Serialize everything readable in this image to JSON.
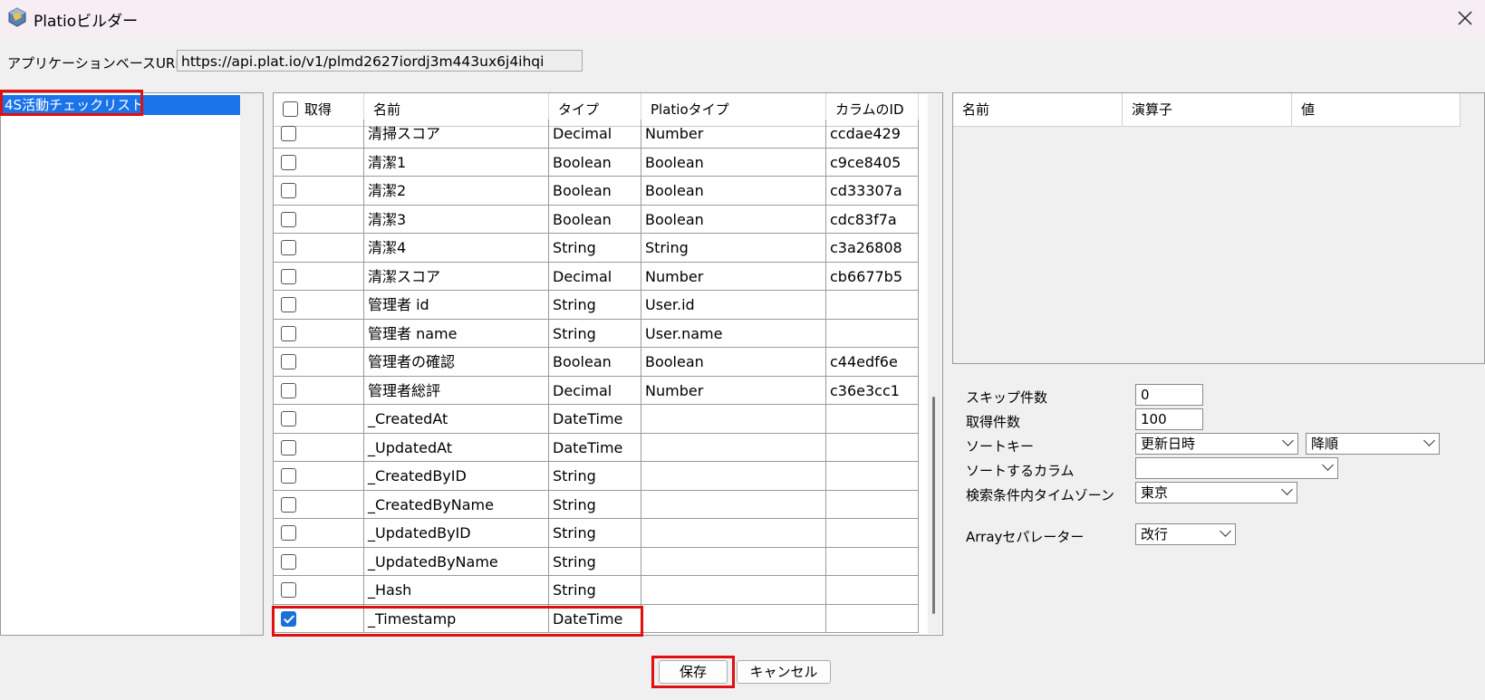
{
  "window": {
    "title": "Platioビルダー",
    "close_icon": "close-icon"
  },
  "url_bar": {
    "label": "アプリケーションベースURL",
    "value": "https://api.plat.io/v1/plmd2627iordj3m443ux6j4ihqi"
  },
  "app_list": {
    "items": [
      "4S活動チェックリスト"
    ],
    "selected": "4S活動チェックリスト"
  },
  "columns_table": {
    "headers": {
      "get": "取得",
      "name": "名前",
      "type": "タイプ",
      "platio_type": "Platioタイプ",
      "column_id": "カラムのID"
    },
    "rows": [
      {
        "checked": false,
        "name": "清掃スコア",
        "type": "Decimal",
        "platio_type": "Number",
        "column_id": "ccdae429"
      },
      {
        "checked": false,
        "name": "清潔1",
        "type": "Boolean",
        "platio_type": "Boolean",
        "column_id": "c9ce8405"
      },
      {
        "checked": false,
        "name": "清潔2",
        "type": "Boolean",
        "platio_type": "Boolean",
        "column_id": "cd33307a"
      },
      {
        "checked": false,
        "name": "清潔3",
        "type": "Boolean",
        "platio_type": "Boolean",
        "column_id": "cdc83f7a"
      },
      {
        "checked": false,
        "name": "清潔4",
        "type": "String",
        "platio_type": "String",
        "column_id": "c3a26808"
      },
      {
        "checked": false,
        "name": "清潔スコア",
        "type": "Decimal",
        "platio_type": "Number",
        "column_id": "cb6677b5"
      },
      {
        "checked": false,
        "name": "管理者 id",
        "type": "String",
        "platio_type": "User.id",
        "column_id": ""
      },
      {
        "checked": false,
        "name": "管理者 name",
        "type": "String",
        "platio_type": "User.name",
        "column_id": ""
      },
      {
        "checked": false,
        "name": "管理者の確認",
        "type": "Boolean",
        "platio_type": "Boolean",
        "column_id": "c44edf6e"
      },
      {
        "checked": false,
        "name": "管理者総評",
        "type": "Decimal",
        "platio_type": "Number",
        "column_id": "c36e3cc1"
      },
      {
        "checked": false,
        "name": "_CreatedAt",
        "type": "DateTime",
        "platio_type": "",
        "column_id": ""
      },
      {
        "checked": false,
        "name": "_UpdatedAt",
        "type": "DateTime",
        "platio_type": "",
        "column_id": ""
      },
      {
        "checked": false,
        "name": "_CreatedByID",
        "type": "String",
        "platio_type": "",
        "column_id": ""
      },
      {
        "checked": false,
        "name": "_CreatedByName",
        "type": "String",
        "platio_type": "",
        "column_id": ""
      },
      {
        "checked": false,
        "name": "_UpdatedByID",
        "type": "String",
        "platio_type": "",
        "column_id": ""
      },
      {
        "checked": false,
        "name": "_UpdatedByName",
        "type": "String",
        "platio_type": "",
        "column_id": ""
      },
      {
        "checked": false,
        "name": "_Hash",
        "type": "String",
        "platio_type": "",
        "column_id": ""
      },
      {
        "checked": true,
        "name": "_Timestamp",
        "type": "DateTime",
        "platio_type": "",
        "column_id": ""
      }
    ]
  },
  "filter_table": {
    "headers": {
      "name": "名前",
      "operator": "演算子",
      "value": "値"
    }
  },
  "options": {
    "skip_label": "スキップ件数",
    "skip_value": "0",
    "count_label": "取得件数",
    "count_value": "100",
    "sort_key_label": "ソートキー",
    "sort_key_value": "更新日時",
    "sort_order_value": "降順",
    "sort_column_label": "ソートするカラム",
    "sort_column_value": "",
    "timezone_label": "検索条件内タイムゾーン",
    "timezone_value": "東京",
    "array_sep_label": "Arrayセパレーター",
    "array_sep_value": "改行"
  },
  "buttons": {
    "save": "保存",
    "cancel": "キャンセル"
  },
  "accent_colors": {
    "selection": "#1a73e8",
    "highlight_box": "#e01010"
  }
}
